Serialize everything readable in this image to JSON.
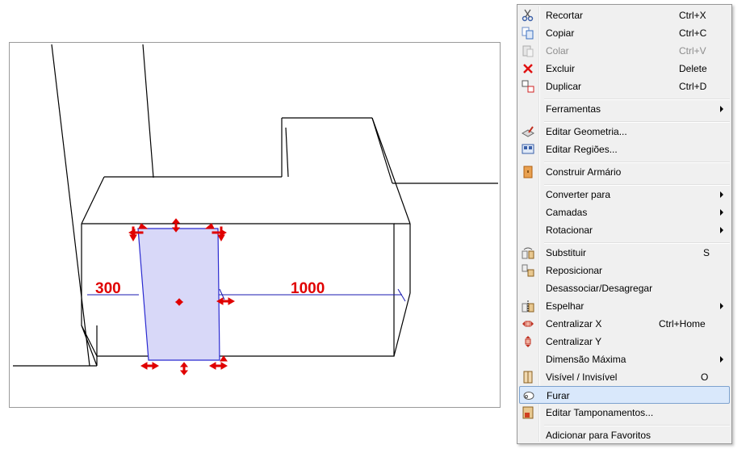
{
  "viewport": {
    "dim_left": "300",
    "dim_right": "1000"
  },
  "menu": {
    "items": [
      {
        "label": "Recortar",
        "shortcut": "Ctrl+X",
        "icon": "scissors-icon"
      },
      {
        "label": "Copiar",
        "shortcut": "Ctrl+C",
        "icon": "copy-icon"
      },
      {
        "label": "Colar",
        "shortcut": "Ctrl+V",
        "icon": "paste-icon",
        "disabled": true
      },
      {
        "label": "Excluir",
        "shortcut": "Delete",
        "icon": "delete-x-icon"
      },
      {
        "label": "Duplicar",
        "shortcut": "Ctrl+D",
        "icon": "duplicate-icon"
      },
      {
        "label": "Ferramentas",
        "submenu": true
      },
      {
        "label": "Editar Geometria...",
        "icon": "edit-geometry-icon"
      },
      {
        "label": "Editar Regiões...",
        "icon": "edit-regions-icon"
      },
      {
        "label": "Construir Armário",
        "icon": "cabinet-icon"
      },
      {
        "label": "Converter para",
        "submenu": true
      },
      {
        "label": "Camadas",
        "submenu": true
      },
      {
        "label": "Rotacionar",
        "submenu": true
      },
      {
        "label": "Substituir",
        "shortcut": "S",
        "icon": "replace-icon"
      },
      {
        "label": "Reposicionar",
        "icon": "reposition-icon"
      },
      {
        "label": "Desassociar/Desagregar"
      },
      {
        "label": "Espelhar",
        "submenu": true,
        "icon": "mirror-icon"
      },
      {
        "label": "Centralizar X",
        "shortcut": "Ctrl+Home",
        "icon": "center-x-icon"
      },
      {
        "label": "Centralizar Y",
        "icon": "center-y-icon"
      },
      {
        "label": "Dimensão Máxima",
        "submenu": true
      },
      {
        "label": "Visível / Invisível",
        "shortcut": "O",
        "icon": "visibility-icon"
      },
      {
        "label": "Furar",
        "icon": "drill-icon",
        "selected": true
      },
      {
        "label": "Editar Tamponamentos...",
        "icon": "edit-caps-icon"
      },
      {
        "label": "Adicionar para Favoritos"
      }
    ]
  },
  "colors": {
    "accent_red": "#e00000",
    "selection_fill": "#d8d8f8",
    "menu_highlight": "#d9e8fb"
  }
}
